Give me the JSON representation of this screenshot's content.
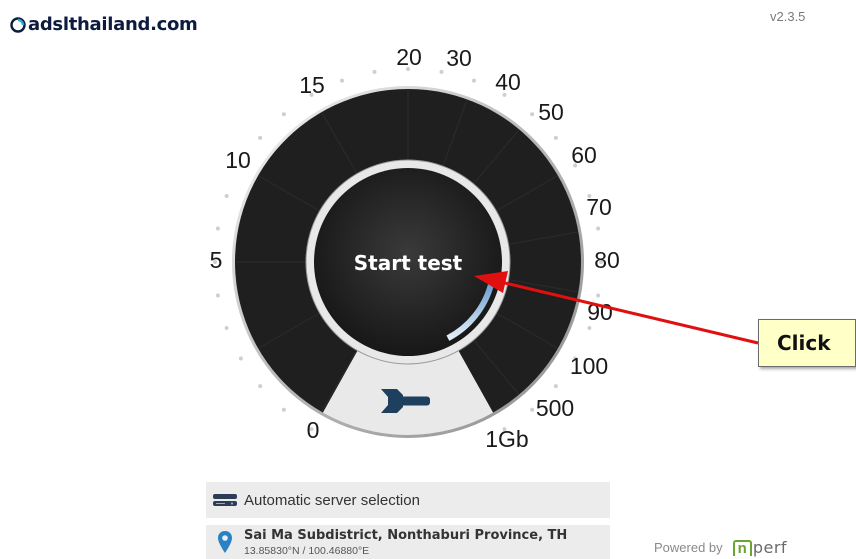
{
  "header": {
    "logo_text": "adslthailand.com",
    "version": "v2.3.5"
  },
  "gauge": {
    "start_button_label": "Start test",
    "scale_labels": [
      "0",
      "5",
      "10",
      "15",
      "20",
      "30",
      "40",
      "50",
      "60",
      "70",
      "80",
      "90",
      "100",
      "500",
      "1Gb"
    ],
    "settings_icon": "wrench-icon",
    "accent_color": "#b9d3ea",
    "dial_color": "#1f1f1f"
  },
  "annotation": {
    "callout_label": "Click",
    "arrow_color": "#e01010",
    "callout_bg": "#ffffc8"
  },
  "server": {
    "icon": "server-icon",
    "label": "Automatic server selection"
  },
  "location": {
    "icon": "map-pin-icon",
    "name": "Sai Ma Subdistrict, Nonthaburi Province, TH",
    "coordinates": "13.85830°N / 100.46880°E"
  },
  "footer": {
    "powered_by": "Powered by",
    "brand_n": "n",
    "brand_rest": "perf"
  }
}
